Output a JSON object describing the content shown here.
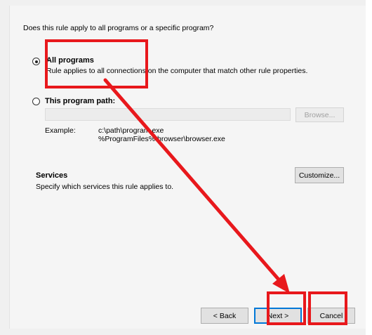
{
  "question": "Does this rule apply to all programs or a specific program?",
  "options": {
    "all_programs": {
      "label": "All programs",
      "description": "Rule applies to all connections on the computer that match other rule properties."
    },
    "this_program": {
      "label": "This program path:",
      "path_value": "",
      "browse_label": "Browse..."
    }
  },
  "example": {
    "label": "Example:",
    "line1": "c:\\path\\program.exe",
    "line2": "%ProgramFiles%\\browser\\browser.exe"
  },
  "services": {
    "title": "Services",
    "description": "Specify which services this rule applies to.",
    "customize_label": "Customize..."
  },
  "footer": {
    "back_label": "< Back",
    "next_label": "Next >",
    "cancel_label": "Cancel"
  },
  "annotation": {
    "color": "#e8181c"
  }
}
